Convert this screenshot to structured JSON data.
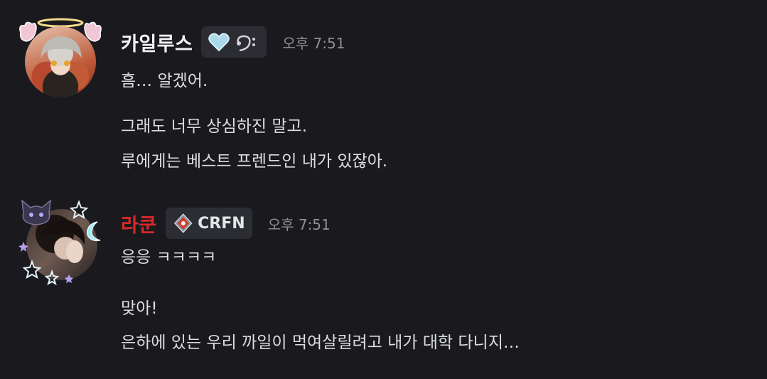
{
  "messages": [
    {
      "username": "카일루스",
      "username_color": "#f2f3f5",
      "timestamp": "오후 7:51",
      "lines": [
        "흠… 알겠어.",
        "그래도 너무 상심하진 말고.",
        "루에게는 베스트 프렌드인 내가 있잖아."
      ]
    },
    {
      "username": "라쿤",
      "username_color": "#d8282a",
      "tag_label": "CRFN",
      "timestamp": "오후 7:51",
      "lines": [
        "응응 ㅋㅋㅋㅋ",
        "맞아!",
        "은하에 있는 우리 까일이 먹여살릴려고 내가 대학 다니지…"
      ]
    }
  ],
  "icons": {
    "msg1_tag": [
      "heart-icon",
      "bass-clef-icon"
    ],
    "msg2_tag": [
      "diamond-pin-icon"
    ],
    "avatar_decoration_1": [
      "halo-icon",
      "angel-wings-icon"
    ],
    "avatar_decoration_2": [
      "cat-icon",
      "moon-icon",
      "star-icon"
    ]
  },
  "colors": {
    "background": "#1a1a1e",
    "text": "#dbdee1",
    "timestamp": "#8e9297",
    "tag_bg": "#2b2d33"
  }
}
